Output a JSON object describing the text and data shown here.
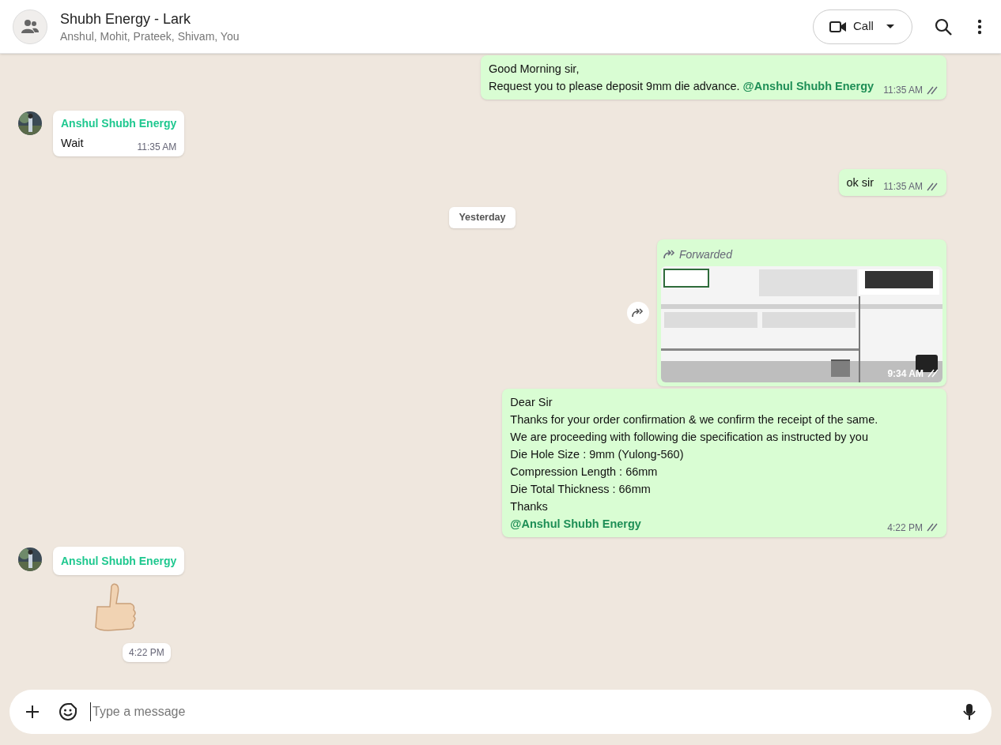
{
  "header": {
    "title": "Shubh Energy - Lark",
    "subtitle": "Anshul, Mohit, Prateek, Shivam, You",
    "call_label": "Call"
  },
  "messages": [
    {
      "kind": "text",
      "outgoing": true,
      "lines": [
        "Good Morning sir,",
        "Request you to please deposit 9mm die advance. **@Anshul Shubh Energy**"
      ],
      "time": "11:35 AM",
      "read": false
    },
    {
      "kind": "text",
      "outgoing": false,
      "sender": "Anshul Shubh Energy",
      "lines": [
        "Wait"
      ],
      "time": "11:35 AM"
    },
    {
      "kind": "text",
      "outgoing": true,
      "lines": [
        "ok sir"
      ],
      "time": "11:35 AM",
      "read": false
    },
    {
      "kind": "date",
      "label": "Yesterday"
    },
    {
      "outgoing": true,
      "forwarded_label": "Forwarded",
      "time": "9:34 AM",
      "read": false
    },
    {
      "kind": "text",
      "outgoing": true,
      "lines": [
        "Dear Sir",
        "Thanks for your order confirmation & we confirm the receipt of the same.",
        "We are proceeding with following die specification as instructed by you",
        "Die Hole Size : 9mm (Yulong-560)",
        "Compression Length : 66mm",
        "Die Total Thickness : 66mm",
        "Thanks",
        "**@Anshul Shubh Energy**"
      ],
      "time": "4:22 PM",
      "read": false
    },
    {
      "kind": "sticker",
      "outgoing": false,
      "sender": "Anshul Shubh Energy",
      "time": "4:22 PM"
    }
  ],
  "composer": {
    "placeholder": "Type a message"
  }
}
